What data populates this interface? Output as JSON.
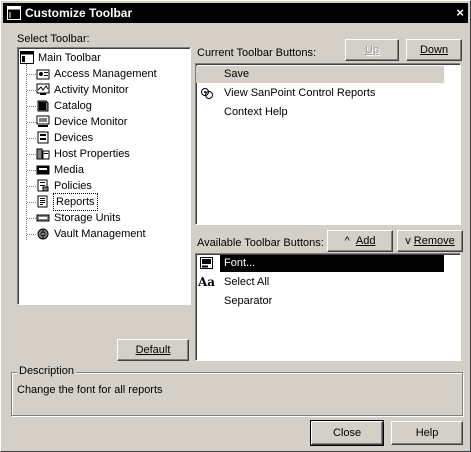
{
  "window": {
    "title": "Customize Toolbar",
    "close_glyph": "×"
  },
  "select_toolbar": {
    "label": "Select Toolbar:",
    "root": {
      "label": "Main Toolbar",
      "icon": "toolbar-icon"
    },
    "items": [
      {
        "label": "Access Management",
        "icon": "access-management-icon"
      },
      {
        "label": "Activity Monitor",
        "icon": "activity-monitor-icon"
      },
      {
        "label": "Catalog",
        "icon": "catalog-icon"
      },
      {
        "label": "Device Monitor",
        "icon": "device-monitor-icon"
      },
      {
        "label": "Devices",
        "icon": "devices-icon"
      },
      {
        "label": "Host Properties",
        "icon": "host-properties-icon"
      },
      {
        "label": "Media",
        "icon": "media-icon"
      },
      {
        "label": "Policies",
        "icon": "policies-icon"
      },
      {
        "label": "Reports",
        "icon": "reports-icon",
        "selected": true
      },
      {
        "label": "Storage Units",
        "icon": "storage-units-icon"
      },
      {
        "label": "Vault Management",
        "icon": "vault-management-icon"
      }
    ],
    "default_button": "Default"
  },
  "current_buttons": {
    "label": "Current Toolbar Buttons:",
    "up_button": "Up",
    "down_button": "Down",
    "items": [
      {
        "label": "Save",
        "icon": "",
        "highlighted": true
      },
      {
        "label": "View SanPoint Control Reports",
        "icon": "sanpoint-icon"
      },
      {
        "label": "Context Help",
        "icon": ""
      }
    ]
  },
  "available_buttons": {
    "label": "Available Toolbar Buttons:",
    "add_button": "Add",
    "add_glyph": "^",
    "remove_button": "Remove",
    "remove_glyph": "v",
    "items": [
      {
        "label": "Font...",
        "icon": "font-icon",
        "selected": true
      },
      {
        "label": "Select All",
        "icon": "select-all-icon",
        "icon_text": "Aa"
      },
      {
        "label": "Separator",
        "icon": ""
      }
    ]
  },
  "description": {
    "title": "Description",
    "text": "Change the font for all reports"
  },
  "footer": {
    "close_button": "Close",
    "help_button": "Help"
  },
  "colors": {
    "title_bar": "#000000",
    "dialog_face": "#d4d0c8",
    "selection": "#000000",
    "highlight_row": "#d4d0c8"
  }
}
